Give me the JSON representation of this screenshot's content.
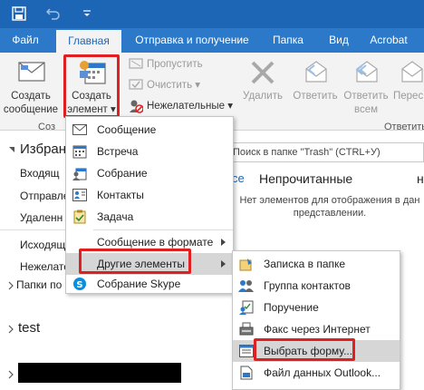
{
  "tabs": {
    "file": "Файл",
    "home": "Главная",
    "send_receive": "Отправка и получение",
    "folder": "Папка",
    "view": "Вид",
    "acrobat": "Acrobat"
  },
  "ribbon": {
    "new_message_line1": "Создать",
    "new_message_line2": "сообщение",
    "new_items_line1": "Создать",
    "new_items_line2": "элемент",
    "ignore": "Пропустить",
    "clean_up": "Очистить",
    "junk": "Нежелательные",
    "delete": "Удалить",
    "reply": "Ответить",
    "reply_all_line1": "Ответить",
    "reply_all_line2": "всем",
    "forward": "Перес",
    "group_new": "Соз",
    "group_respond": "Ответить"
  },
  "nav": {
    "favorites": "Избран",
    "inbox": "Входящ",
    "sent": "Отправле",
    "deleted": "Удаленн",
    "outbox": "Исходящ",
    "junk": "Нежелате",
    "search_folders": "Папки по",
    "test_account": "test"
  },
  "mail_pane": {
    "search_placeholder": "Поиск в папке \"Trash\" (CTRL+У)",
    "filter_partial": "ce",
    "unread": "Непрочитанные",
    "unread_right": "н",
    "empty_line1": "Нет элементов для отображения в дан",
    "empty_line2": "представлении."
  },
  "new_items_menu": {
    "items": [
      {
        "label": "Сообщение",
        "icon": "envelope-icon"
      },
      {
        "label": "Встреча",
        "icon": "calendar-icon"
      },
      {
        "label": "Собрание",
        "icon": "meeting-icon"
      },
      {
        "label": "Контакты",
        "icon": "contact-card-icon"
      },
      {
        "label": "Задача",
        "icon": "task-icon"
      },
      {
        "label": "Сообщение в формате",
        "icon": ""
      },
      {
        "label": "Другие элементы",
        "icon": ""
      },
      {
        "label": "Собрание Skype",
        "icon": "skype-icon"
      }
    ]
  },
  "more_items_menu": {
    "items": [
      {
        "label": "Записка в папке",
        "icon": "post-note-icon"
      },
      {
        "label": "Группа контактов",
        "icon": "contact-group-icon"
      },
      {
        "label": "Поручение",
        "icon": "task-request-icon"
      },
      {
        "label": "Факс через Интернет",
        "icon": "fax-icon"
      },
      {
        "label": "Выбрать форму...",
        "icon": "form-icon"
      },
      {
        "label": "Файл данных Outlook...",
        "icon": "data-file-icon"
      }
    ]
  },
  "colors": {
    "titlebar": "#1d65b5",
    "tabbar": "#2b79c8",
    "highlight_box": "#e02020",
    "menu_highlight": "#d6d6d6"
  }
}
